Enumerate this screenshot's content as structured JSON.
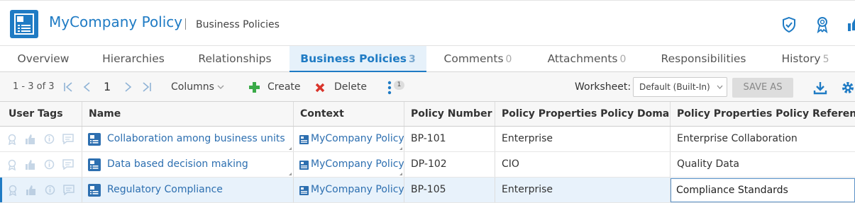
{
  "header": {
    "title": "MyCompany Policy",
    "subtitle": "Business Policies",
    "icons": [
      "shield-check-icon",
      "award-icon",
      "thumbs-up-icon"
    ]
  },
  "tabs": [
    {
      "label": "Overview",
      "count": ""
    },
    {
      "label": "Hierarchies",
      "count": ""
    },
    {
      "label": "Relationships",
      "count": ""
    },
    {
      "label": "Business Policies",
      "count": "3",
      "active": true
    },
    {
      "label": "Comments",
      "count": "0"
    },
    {
      "label": "Attachments",
      "count": "0"
    },
    {
      "label": "Responsibilities",
      "count": ""
    },
    {
      "label": "History",
      "count": "5"
    }
  ],
  "toolbar": {
    "range": "1 - 3 of 3",
    "page": "1",
    "columns_label": "Columns",
    "create_label": "Create",
    "delete_label": "Delete",
    "more_badge": "1",
    "worksheet_label": "Worksheet:",
    "worksheet_value": "Default (Built-In)",
    "save_as_label": "SAVE AS"
  },
  "table": {
    "columns": [
      "User Tags",
      "Name",
      "Context",
      "Policy Number",
      "Policy Properties Policy Domain",
      "Policy Properties Policy Reference"
    ],
    "rows": [
      {
        "name": "Collaboration among business units",
        "context": "MyCompany Policy",
        "number": "BP-101",
        "domain": "Enterprise",
        "reference": "Enterprise Collaboration"
      },
      {
        "name": "Data based decision making",
        "context": "MyCompany Policy",
        "number": "DP-102",
        "domain": "CIO",
        "reference": "Quality Data"
      },
      {
        "name": "Regulatory Compliance",
        "context": "MyCompany Policy",
        "number": "BP-105",
        "domain": "Enterprise",
        "reference": "Compliance Standards",
        "selected": true
      }
    ]
  },
  "colors": {
    "accent": "#1f7bc4",
    "link": "#2d6fb0",
    "create_green": "#3aaa48",
    "delete_red": "#d9342b",
    "selected_row": "#e8f2fb"
  }
}
